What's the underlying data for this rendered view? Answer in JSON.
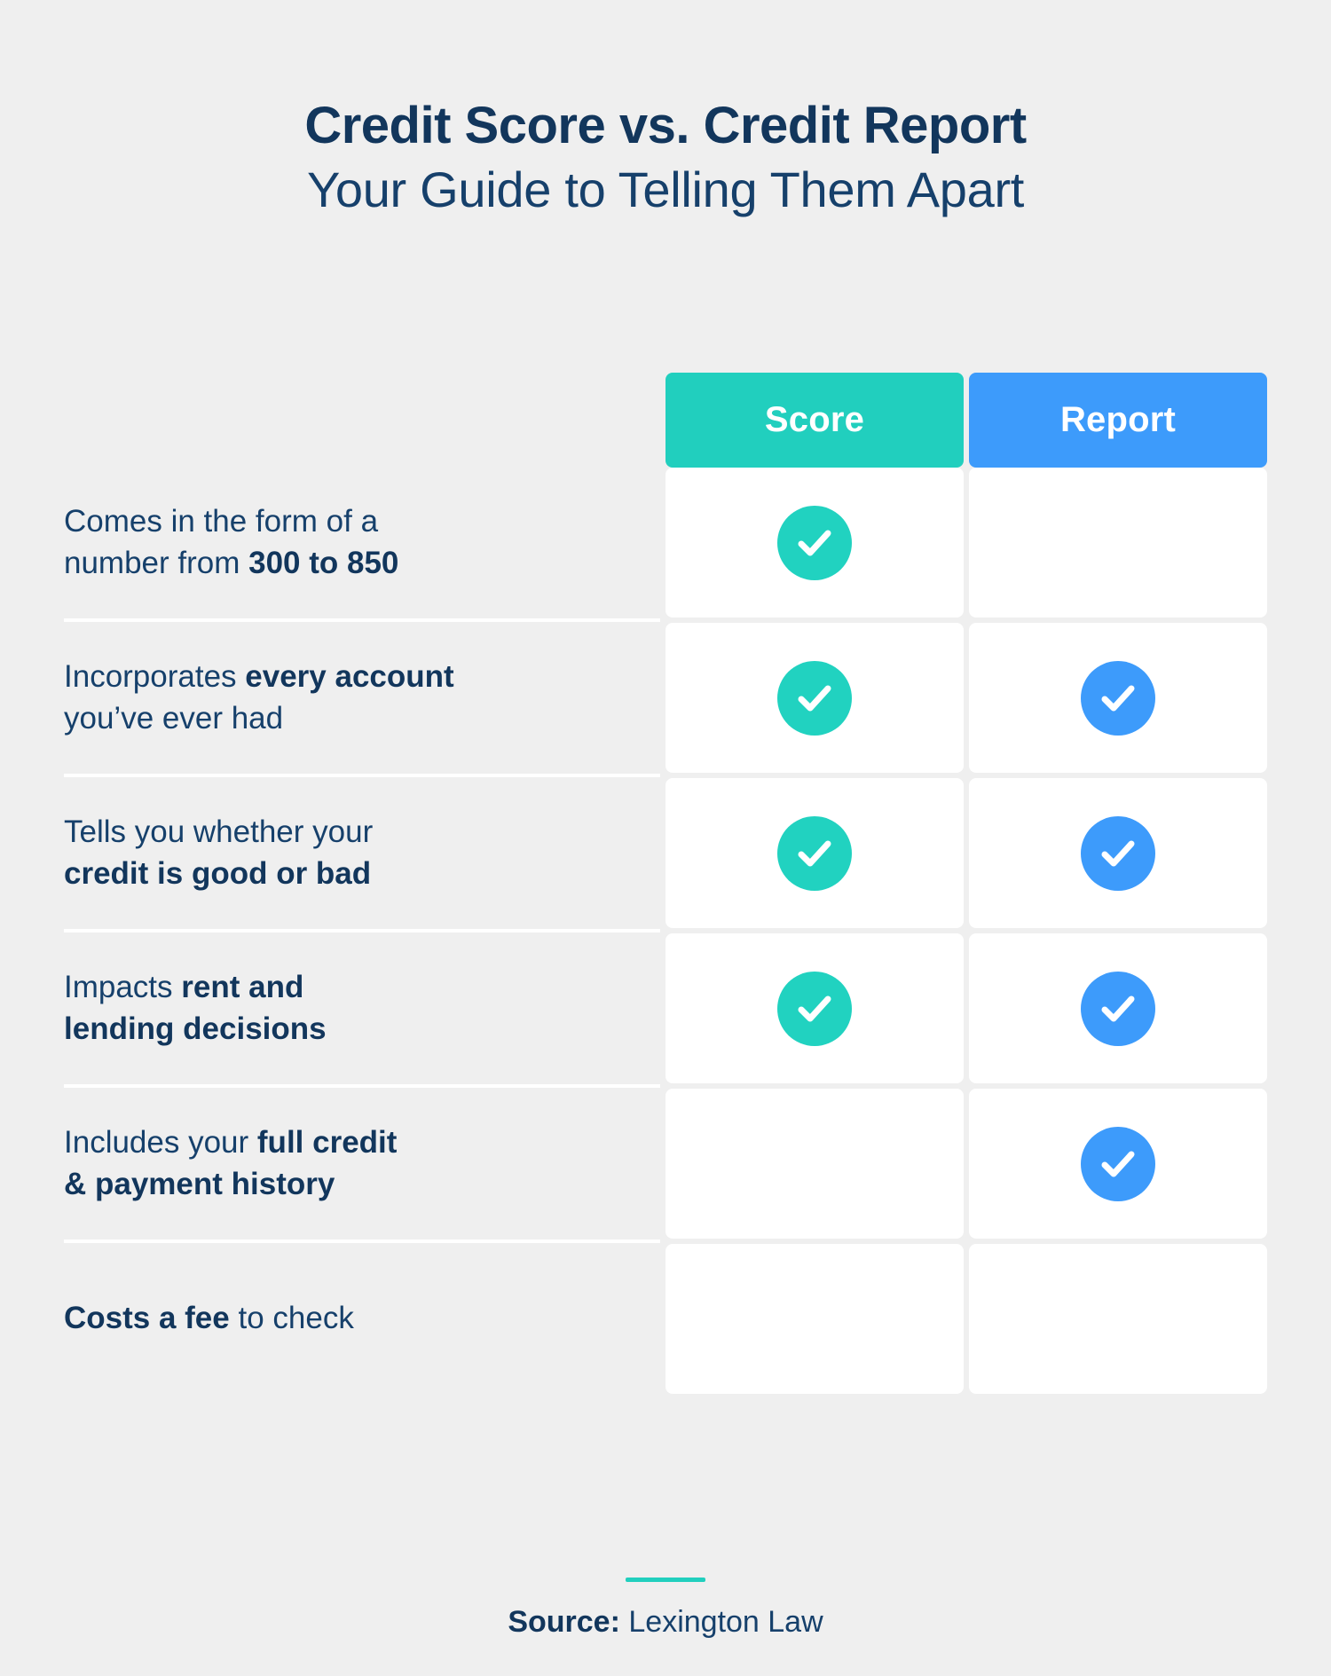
{
  "title": {
    "main": "Credit Score vs. Credit Report",
    "sub": "Your Guide to Telling Them Apart"
  },
  "colors": {
    "background": "#efefef",
    "navy": "#16406b",
    "navy_bold": "#12365c",
    "score_teal": "#21cfbe",
    "report_blue": "#3d9bfb",
    "card_white": "#ffffff"
  },
  "table": {
    "columns": [
      {
        "key": "score",
        "label": "Score",
        "color": "#21cfbe"
      },
      {
        "key": "report",
        "label": "Report",
        "color": "#3d9bfb"
      }
    ],
    "rows": [
      {
        "label_plain": "Comes in the form of a number from 300 to 850",
        "label_html": "Comes in the form of a<br>number from <b>300 to 850</b>",
        "score": true,
        "report": false
      },
      {
        "label_plain": "Incorporates every account you’ve ever had",
        "label_html": "Incorporates <b>every account</b><br>you’ve ever had",
        "score": true,
        "report": true
      },
      {
        "label_plain": "Tells you whether your credit is good or bad",
        "label_html": "Tells you whether your<br><b>credit is good or bad</b>",
        "score": true,
        "report": true
      },
      {
        "label_plain": "Impacts rent and lending decisions",
        "label_html": "Impacts <b>rent and</b><br><b>lending decisions</b>",
        "score": true,
        "report": true
      },
      {
        "label_plain": "Includes your full credit & payment history",
        "label_html": "Includes your <b>full credit</b><br><b>&amp; payment history</b>",
        "score": false,
        "report": true
      },
      {
        "label_plain": "Costs a fee to check",
        "label_html": "<b>Costs a fee</b> to check",
        "score": false,
        "report": false
      }
    ]
  },
  "footer": {
    "source_label": "Source:",
    "source_name": "Lexington Law"
  }
}
